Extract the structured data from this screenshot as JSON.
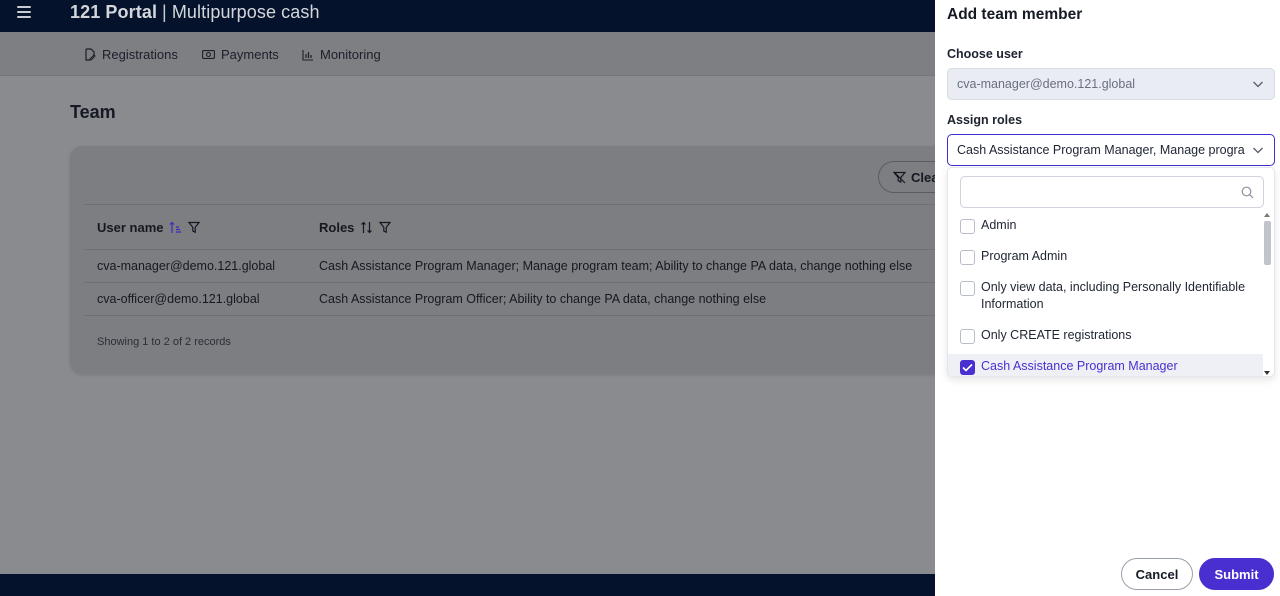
{
  "header": {
    "app_name": "121 Portal",
    "separator": "|",
    "program_name": "Multipurpose cash"
  },
  "nav": {
    "items": [
      {
        "label": "Registrations",
        "icon": "edit-icon"
      },
      {
        "label": "Payments",
        "icon": "cash-icon"
      },
      {
        "label": "Monitoring",
        "icon": "chart-icon"
      }
    ]
  },
  "page": {
    "title": "Team"
  },
  "table": {
    "clear_filters_label": "Clea",
    "columns": [
      {
        "label": "User name",
        "sort": "ascending"
      },
      {
        "label": "Roles",
        "sort": "none"
      }
    ],
    "rows": [
      {
        "user": "cva-manager@demo.121.global",
        "roles": "Cash Assistance Program Manager; Manage program team; Ability to change PA data, change nothing else"
      },
      {
        "user": "cva-officer@demo.121.global",
        "roles": "Cash Assistance Program Officer; Ability to change PA data, change nothing else"
      }
    ],
    "footer": "Showing 1 to 2 of 2 records"
  },
  "panel": {
    "title": "Add team member",
    "choose_user_label": "Choose user",
    "choose_user_value": "cva-manager@demo.121.global",
    "assign_roles_label": "Assign roles",
    "assign_roles_value": "Cash Assistance Program Manager, Manage program team",
    "filter_placeholder": "",
    "options": [
      {
        "label": "Admin",
        "checked": false
      },
      {
        "label": "Program Admin",
        "checked": false
      },
      {
        "label": "Only view data, including Personally Identifiable Information",
        "checked": false
      },
      {
        "label": "Only CREATE registrations",
        "checked": false
      },
      {
        "label": "Cash Assistance Program Manager",
        "checked": true
      }
    ],
    "cancel_label": "Cancel",
    "submit_label": "Submit"
  },
  "colors": {
    "topbar": "#05122b",
    "accent": "#4a2fd0",
    "panel_bg": "#ffffff"
  }
}
